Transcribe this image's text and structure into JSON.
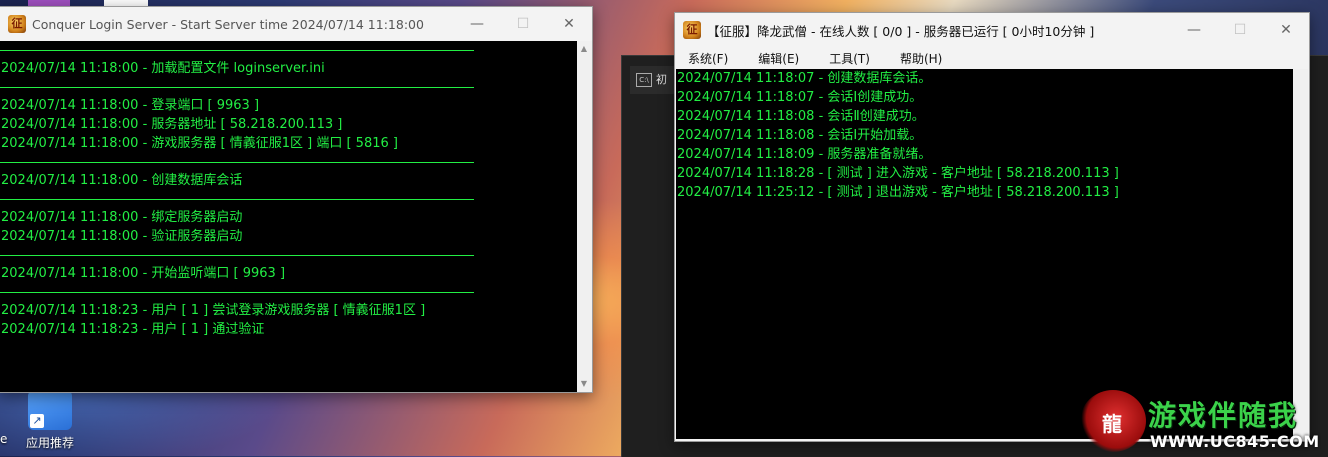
{
  "desktop": {
    "icon_label": "应用推荐",
    "edge_label": "e"
  },
  "login_window": {
    "title": "Conquer Login Server - Start Server time 2024/07/14 11:18:00",
    "minimize_icon": "minimize-icon",
    "maximize_icon": "maximize-icon",
    "close_icon": "close-icon",
    "log": [
      {
        "type": "sep"
      },
      {
        "type": "line",
        "text": "2024/07/14 11:18:00 - 加载配置文件 loginserver.ini"
      },
      {
        "type": "sep"
      },
      {
        "type": "line",
        "text": "2024/07/14 11:18:00 - 登录端口 [ 9963 ]"
      },
      {
        "type": "line",
        "text": "2024/07/14 11:18:00 - 服务器地址 [ 58.218.200.113 ]"
      },
      {
        "type": "line",
        "text": "2024/07/14 11:18:00 - 游戏服务器 [ 情義征服1区 ]  端口 [ 5816 ]"
      },
      {
        "type": "sep"
      },
      {
        "type": "line",
        "text": "2024/07/14 11:18:00 - 创建数据库会话"
      },
      {
        "type": "sep"
      },
      {
        "type": "line",
        "text": "2024/07/14 11:18:00 - 绑定服务器启动"
      },
      {
        "type": "line",
        "text": "2024/07/14 11:18:00 - 验证服务器启动"
      },
      {
        "type": "sep"
      },
      {
        "type": "line",
        "text": "2024/07/14 11:18:00 - 开始监听端口 [ 9963 ]"
      },
      {
        "type": "sep"
      },
      {
        "type": "line",
        "text": "2024/07/14 11:18:23 - 用户 [ 1 ] 尝试登录游戏服务器 [ 情義征服1区 ]"
      },
      {
        "type": "line",
        "text": "2024/07/14 11:18:23 - 用户 [ 1 ] 通过验证"
      }
    ]
  },
  "game_window": {
    "title": "【征服】降龙武僧 - 在线人数 [ 0/0 ] - 服务器已运行 [ 0小时10分钟 ]",
    "menu": [
      "系统(F)",
      "编辑(E)",
      "工具(T)",
      "帮助(H)"
    ],
    "log": [
      "2024/07/14 11:18:07 - 创建数据库会话。",
      "2024/07/14 11:18:07 - 会话Ⅰ创建成功。",
      "2024/07/14 11:18:08 - 会话Ⅱ创建成功。",
      "2024/07/14 11:18:08 - 会话Ⅰ开始加载。",
      "2024/07/14 11:18:09 - 服务器准备就绪。",
      "2024/07/14 11:18:28 - [ 测试 ] 进入游戏 - 客户地址 [ 58.218.200.113 ]",
      "2024/07/14 11:25:12 - [ 测试 ] 退出游戏 - 客户地址 [ 58.218.200.113 ]"
    ]
  },
  "background_terminal": {
    "tab_label": "初"
  },
  "watermark": {
    "name": "游戏伴随我",
    "url": "WWW.UC845.COM"
  },
  "colors": {
    "console_text": "#22ee44",
    "console_bg": "#000000"
  }
}
